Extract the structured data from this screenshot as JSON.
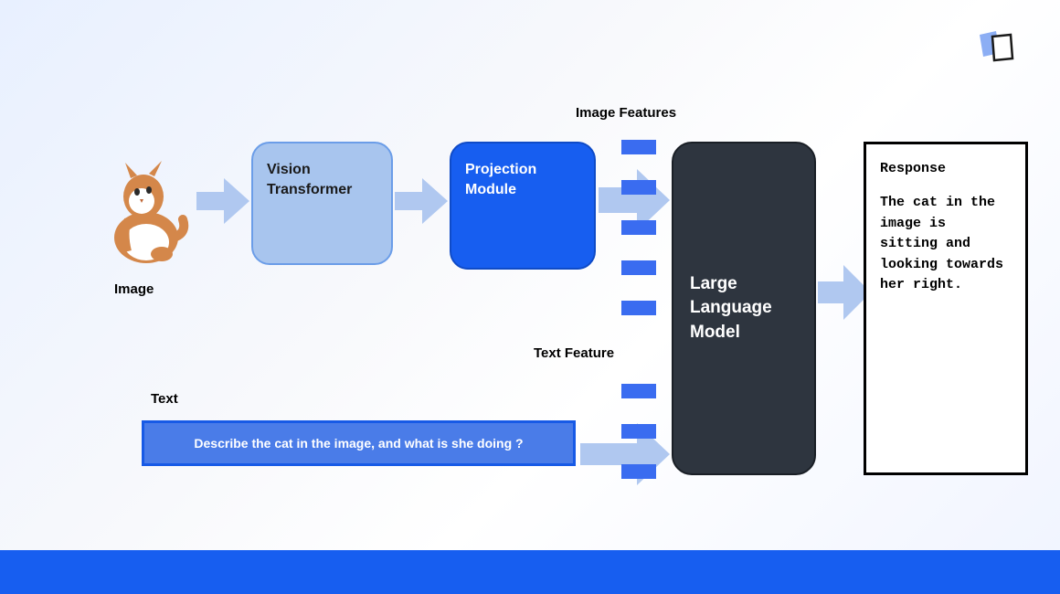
{
  "logo_name": "app-logo",
  "cat_label": "Image",
  "vision_box_text": "Vision Transformer",
  "projection_box_text": "Projection Module",
  "image_features_label": "Image Features",
  "text_feature_label": "Text Feature",
  "text_label": "Text",
  "text_prompt": "Describe the cat in the image, and what is she doing ?",
  "llm_box_text": "Large Language Model",
  "response_title": "Response",
  "response_text": "The cat in the image is sitting and looking towards her right.",
  "arrow_color": "#b0c8f0",
  "token_color": "#3a6cf0"
}
